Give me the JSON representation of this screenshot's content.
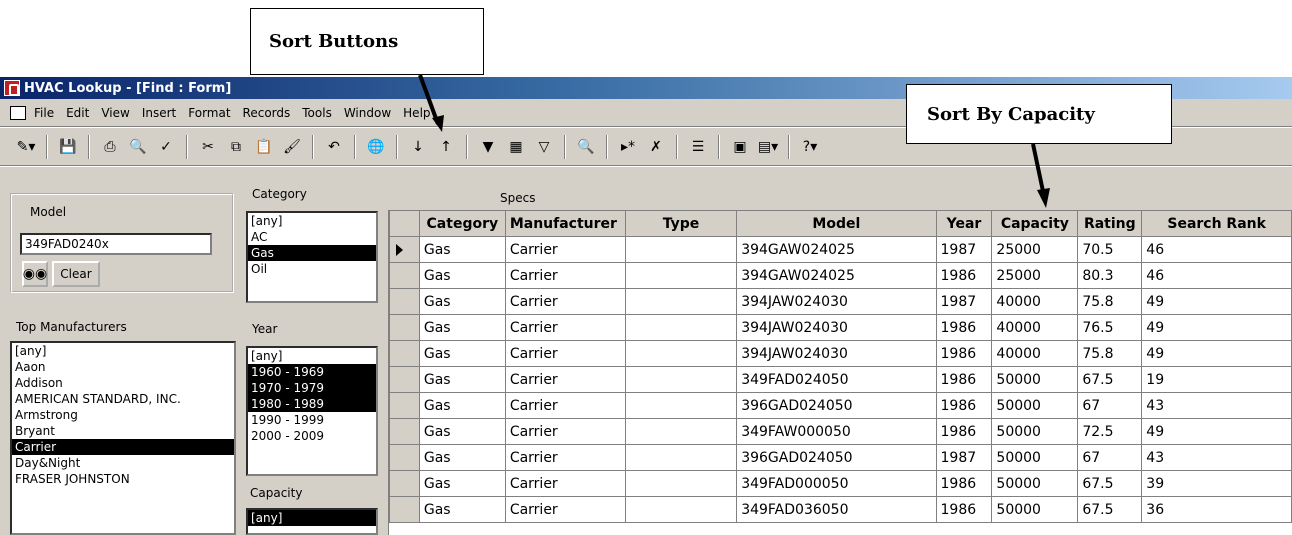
{
  "callouts": {
    "sort_buttons": "Sort Buttons",
    "sort_by_capacity": "Sort By Capacity"
  },
  "window": {
    "title": "HVAC Lookup - [Find : Form]"
  },
  "menu": [
    "File",
    "Edit",
    "View",
    "Insert",
    "Format",
    "Records",
    "Tools",
    "Window",
    "Help"
  ],
  "toolbar_icons": [
    "view-icon",
    "save-icon",
    "print-icon",
    "print-preview-icon",
    "spelling-icon",
    "cut-icon",
    "copy-icon",
    "paste-icon",
    "format-painter-icon",
    "undo-icon",
    "hyperlink-icon",
    "sort-ascending-icon",
    "sort-descending-icon",
    "filter-by-selection-icon",
    "filter-by-form-icon",
    "apply-filter-icon",
    "find-icon",
    "new-record-icon",
    "delete-record-icon",
    "properties-icon",
    "database-window-icon",
    "new-object-icon",
    "help-icon"
  ],
  "form": {
    "model_label": "Model",
    "model_value": "349FAD0240x",
    "find_icon": "binoculars-icon",
    "clear_label": "Clear",
    "category_label": "Category",
    "category_items": [
      "[any]",
      "AC",
      "Gas",
      "Oil"
    ],
    "category_selected": [
      2
    ],
    "specs_label": "Specs",
    "top_manufacturers_label": "Top Manufacturers",
    "manufacturers": [
      "[any]",
      "Aaon",
      "Addison",
      "AMERICAN STANDARD, INC.",
      "Armstrong",
      "Bryant",
      "Carrier",
      "Day&Night",
      "FRASER JOHNSTON"
    ],
    "manufacturers_selected": [
      6
    ],
    "year_label": "Year",
    "year_items": [
      "[any]",
      "1960 - 1969",
      "1970 - 1979",
      "1980 - 1989",
      "1990 - 1999",
      "2000 - 2009"
    ],
    "year_selected": [
      1,
      2,
      3
    ],
    "capacity_label": "Capacity",
    "capacity_items": [
      "[any]"
    ],
    "capacity_selected": [
      0
    ]
  },
  "table": {
    "columns": [
      "Category",
      "Manufacturer",
      "Type",
      "Model",
      "Year",
      "Capacity",
      "Rating",
      "Search Rank"
    ],
    "rows": [
      [
        "Gas",
        "Carrier",
        "",
        "394GAW024025",
        "1987",
        "25000",
        "70.5",
        "46"
      ],
      [
        "Gas",
        "Carrier",
        "",
        "394GAW024025",
        "1986",
        "25000",
        "80.3",
        "46"
      ],
      [
        "Gas",
        "Carrier",
        "",
        "394JAW024030",
        "1987",
        "40000",
        "75.8",
        "49"
      ],
      [
        "Gas",
        "Carrier",
        "",
        "394JAW024030",
        "1986",
        "40000",
        "76.5",
        "49"
      ],
      [
        "Gas",
        "Carrier",
        "",
        "394JAW024030",
        "1986",
        "40000",
        "75.8",
        "49"
      ],
      [
        "Gas",
        "Carrier",
        "",
        "349FAD024050",
        "1986",
        "50000",
        "67.5",
        "19"
      ],
      [
        "Gas",
        "Carrier",
        "",
        "396GAD024050",
        "1986",
        "50000",
        "67",
        "43"
      ],
      [
        "Gas",
        "Carrier",
        "",
        "349FAW000050",
        "1986",
        "50000",
        "72.5",
        "49"
      ],
      [
        "Gas",
        "Carrier",
        "",
        "396GAD024050",
        "1987",
        "50000",
        "67",
        "43"
      ],
      [
        "Gas",
        "Carrier",
        "",
        "349FAD000050",
        "1986",
        "50000",
        "67.5",
        "39"
      ],
      [
        "Gas",
        "Carrier",
        "",
        "349FAD036050",
        "1986",
        "50000",
        "67.5",
        "36"
      ]
    ],
    "current_row": 0
  }
}
